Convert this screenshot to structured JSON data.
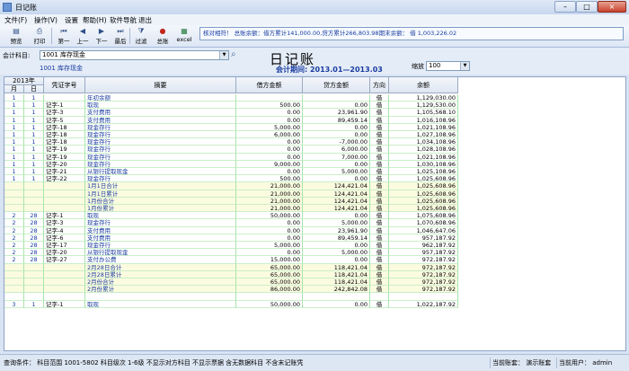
{
  "window": {
    "title": "日记账",
    "min": "–",
    "max": "□",
    "close": "×"
  },
  "menu": [
    "文件(F)",
    "操作(V)",
    "设置",
    "帮助(H)",
    "软件导航",
    "退出"
  ],
  "toolbar": {
    "buttons": [
      {
        "label": "预览",
        "icon": "preview-icon"
      },
      {
        "label": "打印",
        "icon": "print-icon"
      },
      {
        "label": "第一",
        "icon": "first-icon"
      },
      {
        "label": "上一",
        "icon": "prev-icon"
      },
      {
        "label": "下一",
        "icon": "next-icon"
      },
      {
        "label": "最后",
        "icon": "last-icon"
      },
      {
        "label": "过滤",
        "icon": "filter-icon"
      },
      {
        "label": "总账",
        "icon": "ledger-icon"
      },
      {
        "label": "excel",
        "icon": "excel-icon"
      }
    ],
    "icon_glyphs": [
      "▤",
      "⎙",
      "⏮",
      "◀",
      "▶",
      "⏭",
      "⧩",
      "●",
      "▦"
    ]
  },
  "info_text": "核对相符！ 总账余额：借方累计141,000.00,贷方累计266,803.98期末余额： 借 1,003,226.02",
  "filter": {
    "account_label": "会计科目:",
    "account_value": "1001 库存现金",
    "account_name": "1001 库存现金",
    "title": "日记账",
    "period": "会计期间: 2013.01—2013.03",
    "scale_label": "缩放",
    "scale_value": "100"
  },
  "table": {
    "year_header": "2013年",
    "headers": {
      "month": "月",
      "day": "日",
      "voucher": "凭证字号",
      "summary": "摘要",
      "debit": "借方金额",
      "credit": "贷方金额",
      "direction": "方向",
      "balance": "余额"
    },
    "rows": [
      {
        "m": "1",
        "d": "1",
        "v": "",
        "s": "年初余额",
        "dr": "",
        "cr": "",
        "dir": "借",
        "bal": "1,129,030.00",
        "sub": false
      },
      {
        "m": "1",
        "d": "1",
        "v": "记字-1",
        "s": "取现",
        "dr": "500.00",
        "cr": "0.00",
        "dir": "借",
        "bal": "1,129,530.00",
        "sub": false
      },
      {
        "m": "1",
        "d": "1",
        "v": "记字-3",
        "s": "支付费用",
        "dr": "0.00",
        "cr": "23,961.90",
        "dir": "借",
        "bal": "1,105,568.10",
        "sub": false
      },
      {
        "m": "1",
        "d": "1",
        "v": "记字-5",
        "s": "支付费用",
        "dr": "0.00",
        "cr": "89,459.14",
        "dir": "借",
        "bal": "1,016,108.96",
        "sub": false
      },
      {
        "m": "1",
        "d": "1",
        "v": "记字-18",
        "s": "现金存行",
        "dr": "5,000.00",
        "cr": "0.00",
        "dir": "借",
        "bal": "1,021,108.96",
        "sub": false
      },
      {
        "m": "1",
        "d": "1",
        "v": "记字-18",
        "s": "现金存行",
        "dr": "6,000.00",
        "cr": "0.00",
        "dir": "借",
        "bal": "1,027,108.96",
        "sub": false
      },
      {
        "m": "1",
        "d": "1",
        "v": "记字-18",
        "s": "现金存行",
        "dr": "0.00",
        "cr": "-7,000.00",
        "dir": "借",
        "bal": "1,034,108.96",
        "sub": false
      },
      {
        "m": "1",
        "d": "1",
        "v": "记字-19",
        "s": "现金存行",
        "dr": "0.00",
        "cr": "6,000.00",
        "dir": "借",
        "bal": "1,028,108.96",
        "sub": false
      },
      {
        "m": "1",
        "d": "1",
        "v": "记字-19",
        "s": "现金存行",
        "dr": "0.00",
        "cr": "7,000.00",
        "dir": "借",
        "bal": "1,021,108.96",
        "sub": false
      },
      {
        "m": "1",
        "d": "1",
        "v": "记字-20",
        "s": "现金存行",
        "dr": "9,000.00",
        "cr": "0.00",
        "dir": "借",
        "bal": "1,030,108.96",
        "sub": false
      },
      {
        "m": "1",
        "d": "1",
        "v": "记字-21",
        "s": "从银行提取现金",
        "dr": "0.00",
        "cr": "5,000.00",
        "dir": "借",
        "bal": "1,025,108.96",
        "sub": false
      },
      {
        "m": "1",
        "d": "1",
        "v": "记字-22",
        "s": "现金存行",
        "dr": "500.00",
        "cr": "0.00",
        "dir": "借",
        "bal": "1,025,608.96",
        "sub": false
      },
      {
        "m": "",
        "d": "",
        "v": "",
        "s": "1月1日合计",
        "dr": "21,000.00",
        "cr": "124,421.04",
        "dir": "借",
        "bal": "1,025,608.96",
        "sub": true
      },
      {
        "m": "",
        "d": "",
        "v": "",
        "s": "1月1日累计",
        "dr": "21,000.00",
        "cr": "124,421.04",
        "dir": "借",
        "bal": "1,025,608.96",
        "sub": true
      },
      {
        "m": "",
        "d": "",
        "v": "",
        "s": "1月份合计",
        "dr": "21,000.00",
        "cr": "124,421.04",
        "dir": "借",
        "bal": "1,025,608.96",
        "sub": true
      },
      {
        "m": "",
        "d": "",
        "v": "",
        "s": "1月份累计",
        "dr": "21,000.00",
        "cr": "124,421.04",
        "dir": "借",
        "bal": "1,025,608.96",
        "sub": true
      },
      {
        "m": "2",
        "d": "28",
        "v": "记字-1",
        "s": "取现",
        "dr": "50,000.00",
        "cr": "0.00",
        "dir": "借",
        "bal": "1,075,608.96",
        "sub": false
      },
      {
        "m": "2",
        "d": "28",
        "v": "记字-3",
        "s": "现金存行",
        "dr": "0.00",
        "cr": "5,000.00",
        "dir": "借",
        "bal": "1,070,608.96",
        "sub": false
      },
      {
        "m": "2",
        "d": "28",
        "v": "记字-4",
        "s": "支付费用",
        "dr": "0.00",
        "cr": "23,961.90",
        "dir": "借",
        "bal": "1,046,647.06",
        "sub": false
      },
      {
        "m": "2",
        "d": "28",
        "v": "记字-6",
        "s": "支付费用",
        "dr": "0.00",
        "cr": "89,459.14",
        "dir": "借",
        "bal": "957,187.92",
        "sub": false
      },
      {
        "m": "2",
        "d": "28",
        "v": "记字-17",
        "s": "现金存行",
        "dr": "5,000.00",
        "cr": "0.00",
        "dir": "借",
        "bal": "962,187.92",
        "sub": false
      },
      {
        "m": "2",
        "d": "28",
        "v": "记字-20",
        "s": "从银行提取现金",
        "dr": "0.00",
        "cr": "5,000.00",
        "dir": "借",
        "bal": "957,187.92",
        "sub": false
      },
      {
        "m": "2",
        "d": "28",
        "v": "记字-27",
        "s": "支付办公费",
        "dr": "15,000.00",
        "cr": "0.00",
        "dir": "借",
        "bal": "972,187.92",
        "sub": false
      },
      {
        "m": "",
        "d": "",
        "v": "",
        "s": "2月28日合计",
        "dr": "65,000.00",
        "cr": "118,421.04",
        "dir": "借",
        "bal": "972,187.92",
        "sub": true
      },
      {
        "m": "",
        "d": "",
        "v": "",
        "s": "2月28日累计",
        "dr": "65,000.00",
        "cr": "118,421.04",
        "dir": "借",
        "bal": "972,187.92",
        "sub": true
      },
      {
        "m": "",
        "d": "",
        "v": "",
        "s": "2月份合计",
        "dr": "65,000.00",
        "cr": "118,421.04",
        "dir": "借",
        "bal": "972,187.92",
        "sub": true
      },
      {
        "m": "",
        "d": "",
        "v": "",
        "s": "2月份累计",
        "dr": "86,000.00",
        "cr": "242,842.08",
        "dir": "借",
        "bal": "972,187.92",
        "sub": true
      },
      {
        "m": "",
        "d": "",
        "v": "",
        "s": "",
        "dr": "",
        "cr": "",
        "dir": "",
        "bal": "",
        "sub": false
      },
      {
        "m": "3",
        "d": "1",
        "v": "记字-1",
        "s": "取现",
        "dr": "50,000.00",
        "cr": "0.00",
        "dir": "借",
        "bal": "1,022,187.92",
        "sub": false
      }
    ]
  },
  "status": {
    "left": "查询条件： 科目范围 1001-5802   科目级次 1-6级  不显示对方科目 不显示票据 含无数据科目  不含末记账凭",
    "mid": "当前账套： 演示账套",
    "right": "当前用户： admin"
  }
}
